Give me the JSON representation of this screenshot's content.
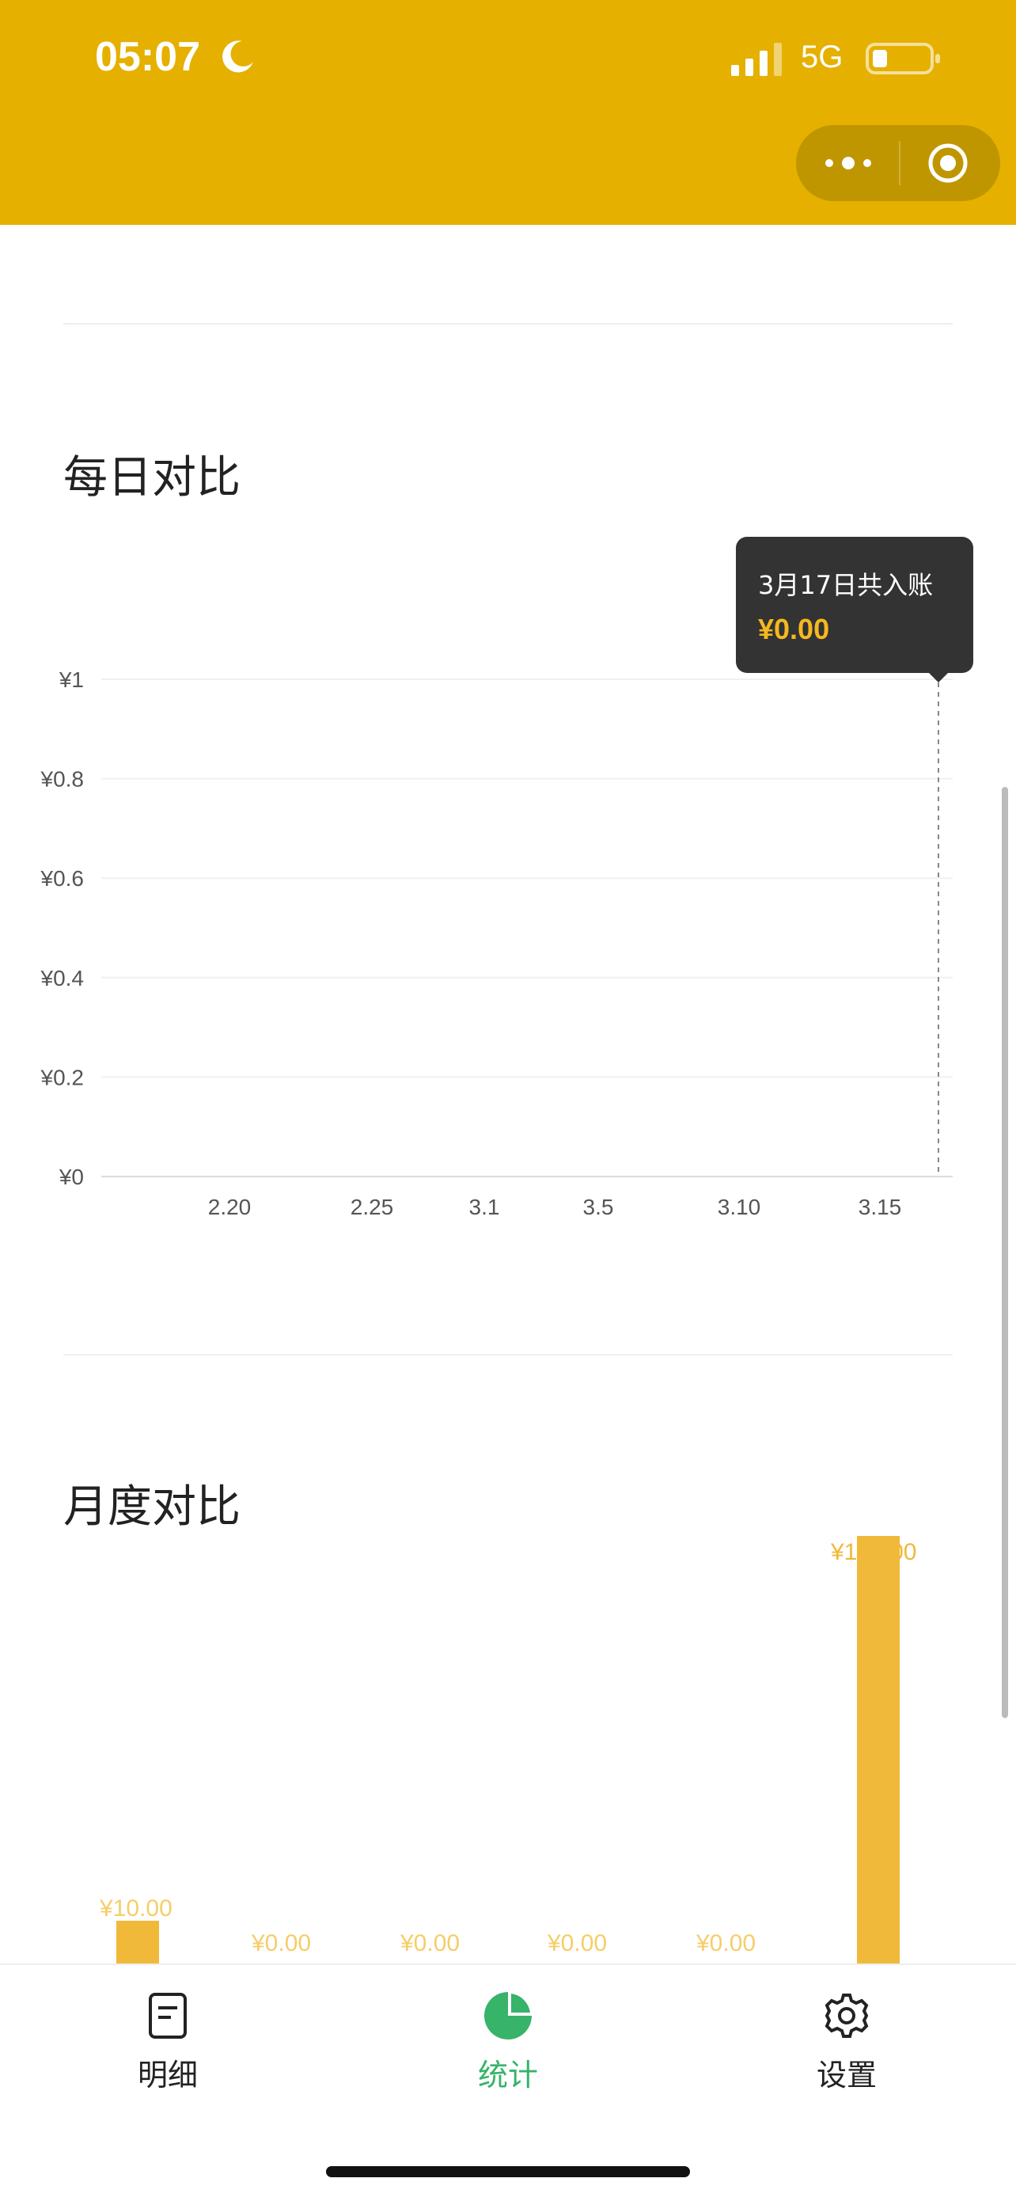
{
  "status_bar": {
    "time": "05:07",
    "network": "5G"
  },
  "sections": {
    "daily_title": "每日对比",
    "monthly_title": "月度对比"
  },
  "daily_chart": {
    "y_ticks": [
      "¥1",
      "¥0.8",
      "¥0.6",
      "¥0.4",
      "¥0.2",
      "¥0"
    ],
    "x_ticks": [
      "2.20",
      "2.25",
      "3.1",
      "3.5",
      "3.10",
      "3.15"
    ],
    "tooltip": {
      "date": "3月17日共入账",
      "amount": "¥0.00"
    }
  },
  "monthly_chart": {
    "bar_labels": [
      "¥10.00",
      "¥0.00",
      "¥0.00",
      "¥0.00",
      "¥0.00",
      "¥100.00"
    ]
  },
  "chart_data": [
    {
      "type": "line",
      "title": "每日对比",
      "x_ticks": [
        "2.20",
        "2.25",
        "3.1",
        "3.5",
        "3.10",
        "3.15"
      ],
      "y_ticks": [
        "¥0",
        "¥0.2",
        "¥0.4",
        "¥0.6",
        "¥0.8",
        "¥1"
      ],
      "ylim": [
        0,
        1
      ],
      "tooltip": {
        "date": "3月17日",
        "value": 0.0
      },
      "grid": true
    },
    {
      "type": "bar",
      "title": "月度对比",
      "values": [
        10,
        0,
        0,
        0,
        0,
        100
      ]
    }
  ],
  "tabs": [
    {
      "label": "明细",
      "icon": "document-icon",
      "active": false
    },
    {
      "label": "统计",
      "icon": "pie-chart-icon",
      "active": true
    },
    {
      "label": "设置",
      "icon": "gear-icon",
      "active": false
    }
  ],
  "colors": {
    "header": "#E5B000",
    "accent_green": "#37B36A",
    "bar": "#F0B93A",
    "bar_label": "#F5CE6A",
    "tooltip_bg": "#333333",
    "tooltip_amount": "#F5B81F"
  }
}
